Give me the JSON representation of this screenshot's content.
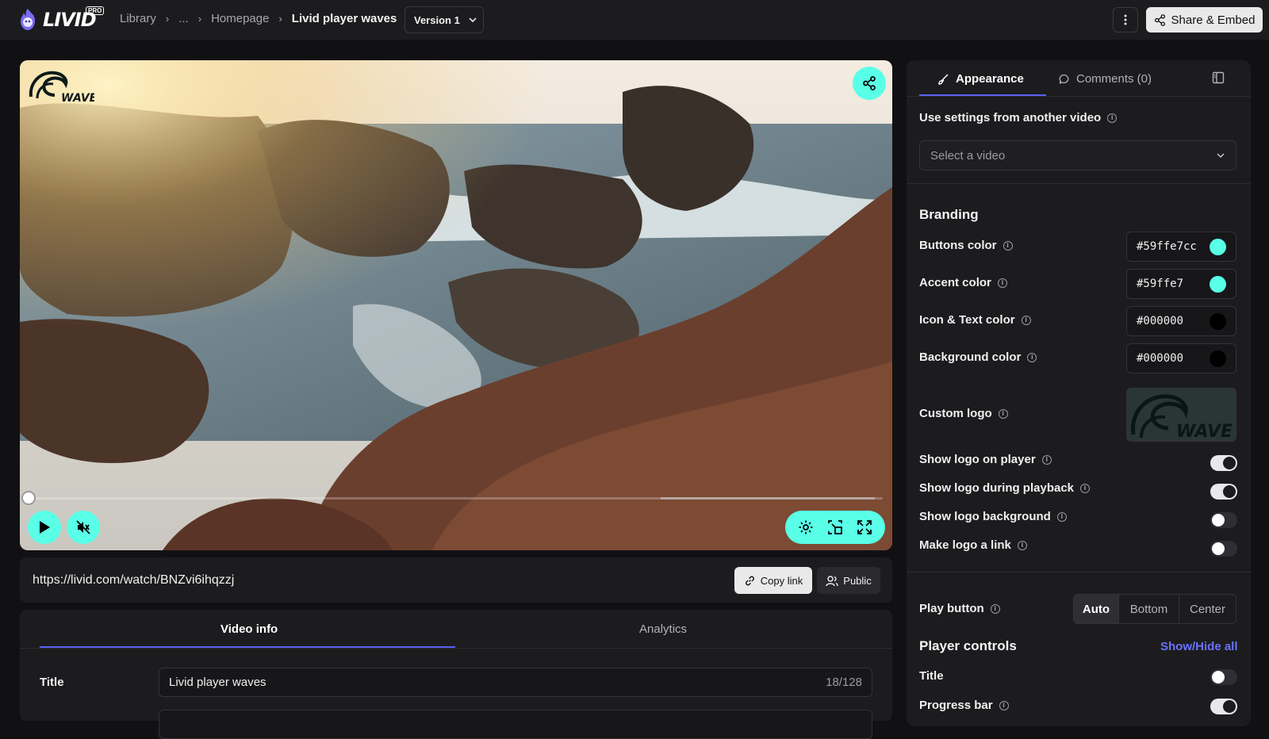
{
  "app": {
    "brand": "LIVID",
    "badge": "PRO"
  },
  "breadcrumb": [
    {
      "label": "Library"
    },
    {
      "label": "..."
    },
    {
      "label": "Homepage"
    },
    {
      "label": "Livid player waves"
    }
  ],
  "header": {
    "version_label": "Version 1",
    "share_embed_label": "Share & Embed"
  },
  "player": {
    "logo_text": "WAVE",
    "progress_fraction": 0.0,
    "buffer_start_fraction": 0.74
  },
  "link_bar": {
    "url": "https://livid.com/watch/BNZvi6ihqzzj",
    "copy_label": "Copy link",
    "visibility_label": "Public"
  },
  "video_info": {
    "tabs": [
      {
        "label": "Video info",
        "active": true
      },
      {
        "label": "Analytics",
        "active": false
      }
    ],
    "title_label": "Title",
    "title_value": "Livid player waves",
    "title_count": "18/128"
  },
  "panel": {
    "tabs": [
      {
        "label": "Appearance",
        "active": true
      },
      {
        "label": "Comments (0)",
        "active": false
      }
    ],
    "use_settings_label": "Use settings from another video",
    "select_placeholder": "Select a video",
    "branding_title": "Branding",
    "colors": [
      {
        "label": "Buttons color",
        "value": "#59ffe7cc",
        "swatch": "#59ffe7"
      },
      {
        "label": "Accent color",
        "value": "#59ffe7",
        "swatch": "#59ffe7"
      },
      {
        "label": "Icon & Text color",
        "value": "#000000",
        "swatch": "#000000"
      },
      {
        "label": "Background color",
        "value": "#000000",
        "swatch": "#000000"
      }
    ],
    "custom_logo_label": "Custom logo",
    "logo_toggles": [
      {
        "label": "Show logo on player",
        "on": true
      },
      {
        "label": "Show logo during playback",
        "on": true
      },
      {
        "label": "Show logo background",
        "on": false
      },
      {
        "label": "Make logo a link",
        "on": false
      }
    ],
    "play_button": {
      "label": "Play button",
      "options": [
        "Auto",
        "Bottom",
        "Center"
      ],
      "selected": "Auto"
    },
    "player_controls_title": "Player controls",
    "show_hide_all_label": "Show/Hide all",
    "control_toggles": [
      {
        "label": "Title",
        "on": false,
        "info": false
      },
      {
        "label": "Progress bar",
        "on": true,
        "info": true
      }
    ]
  },
  "colors": {
    "accent": "#59ffe7",
    "tab_underline": "#5a5ff0",
    "link": "#6a72ff"
  }
}
